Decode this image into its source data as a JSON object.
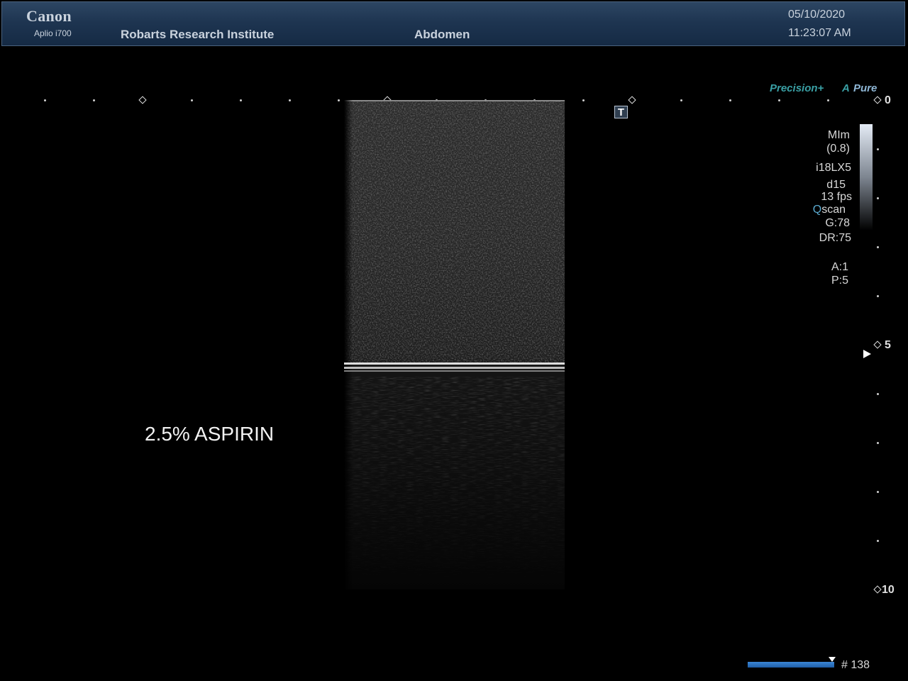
{
  "header": {
    "brand": "Canon",
    "model": "Aplio i700",
    "institute": "Robarts Research Institute",
    "preset": "Abdomen",
    "date": "05/10/2020",
    "time": "11:23:07 AM"
  },
  "image": {
    "sample_label": "2.5% ASPIRIN"
  },
  "overlay": {
    "t_marker": "T",
    "focus_marker_icon": "triangle-right-icon"
  },
  "modes": {
    "precision": "Precision+",
    "apure_a": "A",
    "apure_pure": "Pure"
  },
  "parameters": {
    "mi_label": "MIm",
    "mi_value": "(0.8)",
    "transducer": "i18LX5",
    "depth": "d15",
    "frame_rate": "13 fps",
    "qscan_q": "Q",
    "qscan_rest": "scan",
    "gain": "G:78",
    "dynamic_range": "DR:75",
    "a_value": "A:1",
    "p_value": "P:5"
  },
  "depth_scale": {
    "top": "0",
    "mid": "5",
    "bottom": "10"
  },
  "cine": {
    "frame": "# 138",
    "position": 0.93
  },
  "colors": {
    "header_bg": "#1e3551",
    "accent_teal": "#3aa0a5",
    "cine_blue": "#2f78c8"
  }
}
